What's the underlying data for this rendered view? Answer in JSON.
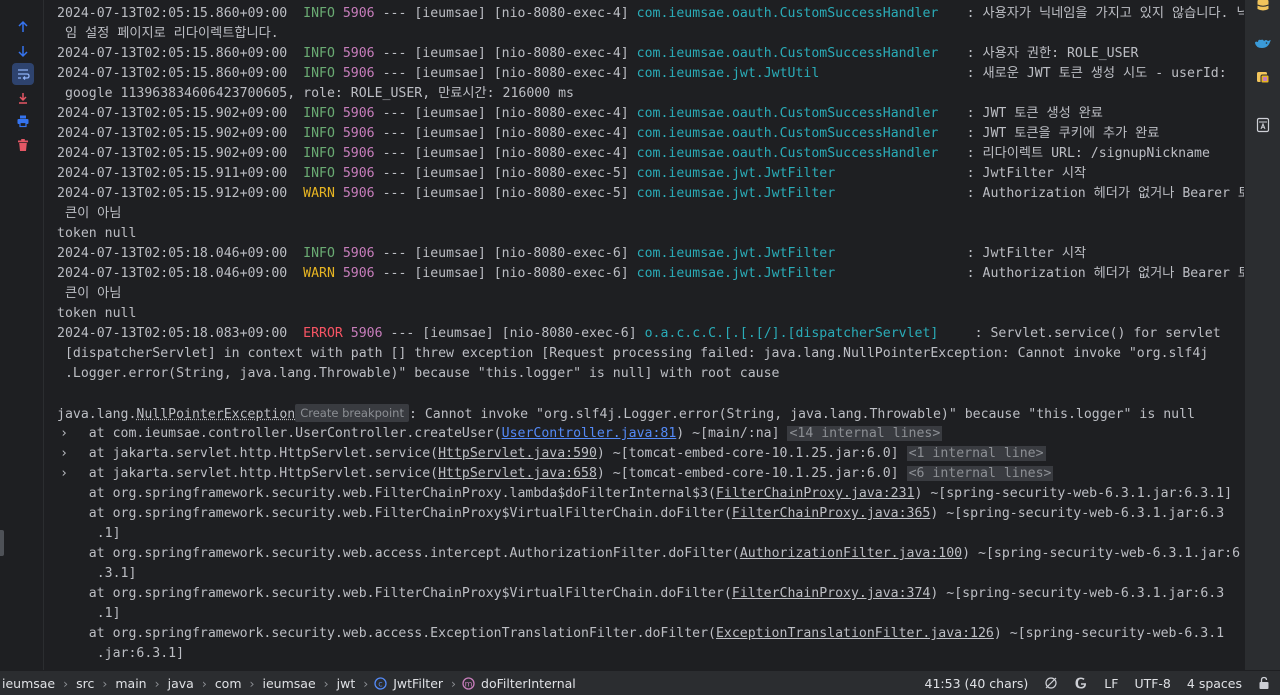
{
  "console": {
    "lines": [
      {
        "ts": "2024-07-13T02:05:15.860+09:00",
        "level": "INFO",
        "pid": "5906",
        "thread": "--- [ieumsae] [nio-8080-exec-4]",
        "logger": "com.ieumsae.oauth.CustomSuccessHandler",
        "msg": ": 사용자가 닉네임을 가지고 있지 않습니다. 닉네"
      },
      {
        "text": " 임 설정 페이지로 리다이렉트합니다."
      },
      {
        "ts": "2024-07-13T02:05:15.860+09:00",
        "level": "INFO",
        "pid": "5906",
        "thread": "--- [ieumsae] [nio-8080-exec-4]",
        "logger": "com.ieumsae.oauth.CustomSuccessHandler",
        "msg": ": 사용자 권한: ROLE_USER"
      },
      {
        "ts": "2024-07-13T02:05:15.860+09:00",
        "level": "INFO",
        "pid": "5906",
        "thread": "--- [ieumsae] [nio-8080-exec-4]",
        "logger": "com.ieumsae.jwt.JwtUtil",
        "msg": ": 새로운 JWT 토큰 생성 시도 - userId:"
      },
      {
        "text": " google 113963834606423700605, role: ROLE_USER, 만료시간: 216000 ms"
      },
      {
        "ts": "2024-07-13T02:05:15.902+09:00",
        "level": "INFO",
        "pid": "5906",
        "thread": "--- [ieumsae] [nio-8080-exec-4]",
        "logger": "com.ieumsae.oauth.CustomSuccessHandler",
        "msg": ": JWT 토큰 생성 완료"
      },
      {
        "ts": "2024-07-13T02:05:15.902+09:00",
        "level": "INFO",
        "pid": "5906",
        "thread": "--- [ieumsae] [nio-8080-exec-4]",
        "logger": "com.ieumsae.oauth.CustomSuccessHandler",
        "msg": ": JWT 토큰을 쿠키에 추가 완료"
      },
      {
        "ts": "2024-07-13T02:05:15.902+09:00",
        "level": "INFO",
        "pid": "5906",
        "thread": "--- [ieumsae] [nio-8080-exec-4]",
        "logger": "com.ieumsae.oauth.CustomSuccessHandler",
        "msg": ": 리다이렉트 URL: /signupNickname"
      },
      {
        "ts": "2024-07-13T02:05:15.911+09:00",
        "level": "INFO",
        "pid": "5906",
        "thread": "--- [ieumsae] [nio-8080-exec-5]",
        "logger": "com.ieumsae.jwt.JwtFilter",
        "msg": ": JwtFilter 시작"
      },
      {
        "ts": "2024-07-13T02:05:15.912+09:00",
        "level": "WARN",
        "pid": "5906",
        "thread": "--- [ieumsae] [nio-8080-exec-5]",
        "logger": "com.ieumsae.jwt.JwtFilter",
        "msg": ": Authorization 헤더가 없거나 Bearer 토"
      },
      {
        "text": " 큰이 아님"
      },
      {
        "text": "token null"
      },
      {
        "ts": "2024-07-13T02:05:18.046+09:00",
        "level": "INFO",
        "pid": "5906",
        "thread": "--- [ieumsae] [nio-8080-exec-6]",
        "logger": "com.ieumsae.jwt.JwtFilter",
        "msg": ": JwtFilter 시작"
      },
      {
        "ts": "2024-07-13T02:05:18.046+09:00",
        "level": "WARN",
        "pid": "5906",
        "thread": "--- [ieumsae] [nio-8080-exec-6]",
        "logger": "com.ieumsae.jwt.JwtFilter",
        "msg": ": Authorization 헤더가 없거나 Bearer 토"
      },
      {
        "text": " 큰이 아님"
      },
      {
        "text": "token null"
      },
      {
        "ts": "2024-07-13T02:05:18.083+09:00",
        "level": "ERROR",
        "pid": "5906",
        "thread": "--- [ieumsae] [nio-8080-exec-6]",
        "logger": "o.a.c.c.C.[.[.[/].[dispatcherServlet]",
        "msg": ": Servlet.service() for servlet"
      },
      {
        "text": " [dispatcherServlet] in context with path [] threw exception [Request processing failed: java.lang.NullPointerException: Cannot invoke \"org.slf4j"
      },
      {
        "text": " .Logger.error(String, java.lang.Throwable)\" because \"this.logger\" is null] with root cause"
      },
      {
        "text": ""
      },
      {
        "exc_pre": "java.lang.",
        "exc_name": "NullPointerException",
        "tooltip": "Create breakpoint",
        "exc_msg": ": Cannot invoke \"org.slf4j.Logger.error(String, java.lang.Throwable)\" because \"this.logger\" is null"
      },
      {
        "pre": "    at com.ieumsae.controller.UserController.createUser(",
        "file": "UserController.java:81",
        "file_style": "link",
        "post": ") ~[main/:na] ",
        "internal": "<14 internal lines>",
        "fold": true
      },
      {
        "pre": "    at jakarta.servlet.http.HttpServlet.service(",
        "file": "HttpServlet.java:590",
        "file_style": "u",
        "post": ") ~[tomcat-embed-core-10.1.25.jar:6.0] ",
        "internal": "<1 internal line>",
        "fold": true
      },
      {
        "pre": "    at jakarta.servlet.http.HttpServlet.service(",
        "file": "HttpServlet.java:658",
        "file_style": "u",
        "post": ") ~[tomcat-embed-core-10.1.25.jar:6.0] ",
        "internal": "<6 internal lines>",
        "fold": true
      },
      {
        "pre": "    at org.springframework.security.web.FilterChainProxy.lambda$doFilterInternal$3(",
        "file": "FilterChainProxy.java:231",
        "file_style": "u",
        "post": ") ~[spring-security-web-6.3.1.jar:6.3.1]"
      },
      {
        "pre": "    at org.springframework.security.web.FilterChainProxy$VirtualFilterChain.doFilter(",
        "file": "FilterChainProxy.java:365",
        "file_style": "u",
        "post": ") ~[spring-security-web-6.3.1.jar:6.3"
      },
      {
        "text": "     .1]"
      },
      {
        "pre": "    at org.springframework.security.web.access.intercept.AuthorizationFilter.doFilter(",
        "file": "AuthorizationFilter.java:100",
        "file_style": "u",
        "post": ") ~[spring-security-web-6.3.1.jar:6"
      },
      {
        "text": "     .3.1]"
      },
      {
        "pre": "    at org.springframework.security.web.FilterChainProxy$VirtualFilterChain.doFilter(",
        "file": "FilterChainProxy.java:374",
        "file_style": "u",
        "post": ") ~[spring-security-web-6.3.1.jar:6.3"
      },
      {
        "text": "     .1]"
      },
      {
        "pre": "    at org.springframework.security.web.access.ExceptionTranslationFilter.doFilter(",
        "file": "ExceptionTranslationFilter.java:126",
        "file_style": "u",
        "post": ") ~[spring-security-web-6.3.1"
      },
      {
        "text": "     .jar:6.3.1]"
      }
    ]
  },
  "left_toolbar": {
    "icons": [
      "arrow-up-icon",
      "arrow-down-icon",
      "soft-wrap-icon",
      "scroll-to-end-icon",
      "print-icon",
      "trash-icon"
    ]
  },
  "right_toolbar": {
    "icons": [
      "database-icon",
      "docker-icon",
      "plugin-icon",
      "reader-mode-icon"
    ]
  },
  "status_bar": {
    "breadcrumbs": [
      "ieumsae",
      "src",
      "main",
      "java",
      "com",
      "ieumsae",
      "jwt",
      "JwtFilter",
      "doFilterInternal"
    ],
    "position": "41:53 (40 chars)",
    "line_ending": "LF",
    "encoding": "UTF-8",
    "indent": "4 spaces"
  },
  "colors": {
    "background": "#1e1f22",
    "text": "#bcbec4",
    "info": "#6aab73",
    "warn": "#e6b422",
    "error": "#f75464",
    "pid": "#c77dbb",
    "logger": "#2aacb8",
    "link": "#548af7"
  }
}
